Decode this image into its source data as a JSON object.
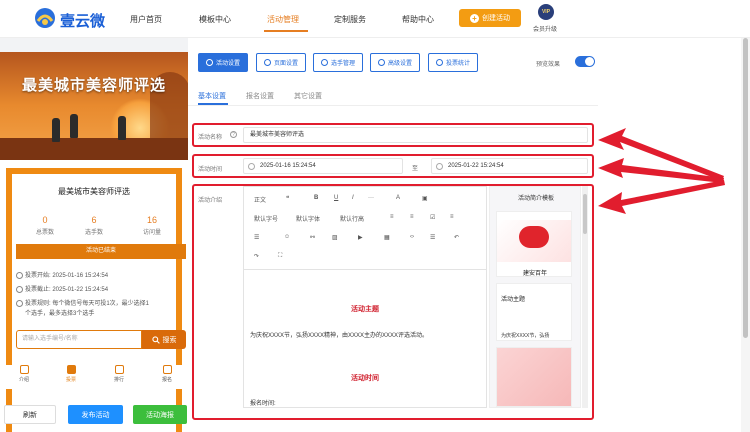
{
  "brand": {
    "name": "壹云微"
  },
  "nav": {
    "items": [
      "用户首页",
      "模板中心",
      "活动管理",
      "定制服务",
      "帮助中心"
    ],
    "create_label": "创建活动",
    "vip_badge": "VIP",
    "vip_label": "会员升级"
  },
  "preview": {
    "banner_title": "最美城市美容师评选",
    "card_title": "最美城市美容师评选",
    "stats": [
      {
        "value": "0",
        "label": "总票数"
      },
      {
        "value": "6",
        "label": "选手数"
      },
      {
        "value": "16",
        "label": "访问量"
      }
    ],
    "status": "活动已结束",
    "info": [
      "投票开始: 2025-01-16 15:24:54",
      "投票截止: 2025-01-22 15:24:54",
      "投票规则: 每个微信号每天可投1次，最少选择1个选手，最多选择3个选手"
    ],
    "search_placeholder": "请输入选手编号/名称",
    "search_label": "搜索",
    "bottom_nav": [
      "介绍",
      "投票",
      "排行",
      "报名"
    ],
    "buttons": {
      "refresh": "刷新",
      "publish": "发布活动",
      "poster": "活动海报"
    }
  },
  "toolbar": {
    "buttons": [
      "活动设置",
      "页面设置",
      "选手管理",
      "高级设置",
      "投票统计"
    ],
    "preview_label": "预览效果",
    "preview_on": true
  },
  "subtabs": [
    "基本设置",
    "报名设置",
    "其它设置"
  ],
  "form": {
    "name_label": "活动名称",
    "name_value": "最美城市美容师评选",
    "time_label": "活动时间",
    "time_start": "2025-01-16 15:24:54",
    "time_sep": "至",
    "time_end": "2025-01-22 15:24:54",
    "intro_label": "活动介绍"
  },
  "editor": {
    "toolbar_row1": [
      "正文",
      "❝",
      "B",
      "U",
      "I",
      "···",
      "A",
      "▣"
    ],
    "toolbar_row2": [
      "默认字号",
      "默认字体",
      "默认行高",
      "≡",
      "≡",
      "☑",
      "≡"
    ],
    "heading1": "活动主题",
    "body1": "为庆祝XXXX节，弘扬XXXX精神，由XXXX主办的XXXX评选活动。",
    "heading2": "活动时间",
    "body2": "报名时间:"
  },
  "templates": {
    "title": "活动简介模板",
    "card1_caption": "建安百年",
    "card2_title": "活动主题",
    "card2_body": "为庆祝XXXX节，弘扬"
  },
  "colors": {
    "accent": "#2a6fdb",
    "orange": "#e67e22",
    "highlight": "#e11d2e"
  }
}
